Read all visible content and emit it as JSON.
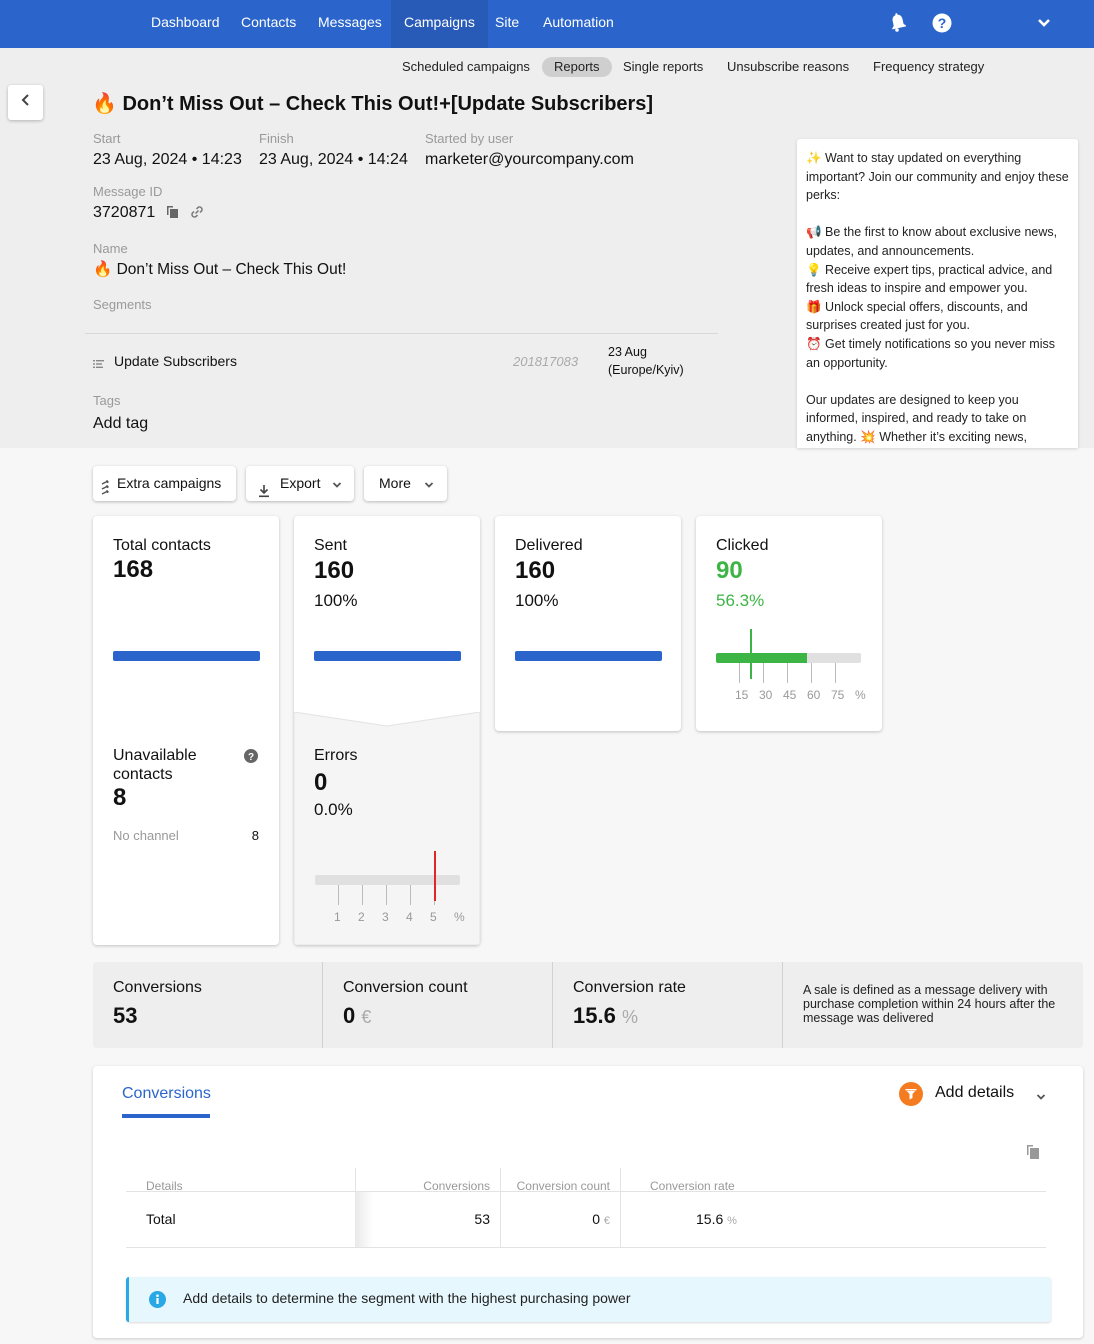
{
  "topnav": {
    "items": [
      {
        "label": "Dashboard"
      },
      {
        "label": "Contacts"
      },
      {
        "label": "Messages"
      },
      {
        "label": "Campaigns",
        "active": true
      },
      {
        "label": "Site"
      },
      {
        "label": "Automation"
      }
    ],
    "icons": [
      "bell-icon",
      "help-icon",
      "chevron-down-icon"
    ]
  },
  "subnav": {
    "items": [
      {
        "label": "Scheduled campaigns"
      },
      {
        "label": "Reports",
        "active": true
      },
      {
        "label": "Single reports"
      },
      {
        "label": "Unsubscribe reasons"
      },
      {
        "label": "Frequency strategy"
      }
    ]
  },
  "campaign": {
    "title": "🔥 Don’t Miss Out – Check This Out!+[Update Subscribers]",
    "start_label": "Start",
    "start_value": "23 Aug, 2024 • 14:23",
    "finish_label": "Finish",
    "finish_value": "23 Aug, 2024 • 14:24",
    "user_label": "Started by user",
    "user_value": "marketer@yourcompany.com",
    "message_id_label": "Message ID",
    "message_id_value": "3720871",
    "name_label": "Name",
    "name_value": "🔥 Don’t Miss Out – Check This Out!",
    "segments_label": "Segments",
    "segment": {
      "name": "Update Subscribers",
      "id": "201817083",
      "date": "23 Aug",
      "timezone": "(Europe/Kyiv)"
    },
    "tags_label": "Tags",
    "add_tag": "Add tag"
  },
  "preview": {
    "text": "✨ Want to stay updated on everything important? Join our community and enjoy these perks:\n\n📢 Be the first to know about exclusive news, updates, and announcements.\n💡 Receive expert tips, practical advice, and fresh ideas to inspire and empower you.\n🎁 Unlock special offers, discounts, and surprises created just for you.\n⏰ Get timely notifications so you never miss an opportunity.\n\nOur updates are designed to keep you informed, inspired, and ready to take on anything. 💥 Whether it’s exciting news,"
  },
  "actions": {
    "extra_campaigns": "Extra campaigns",
    "export": "Export",
    "more": "More"
  },
  "stats": {
    "total": {
      "label": "Total contacts",
      "value": "168",
      "bar_fraction": 1.0
    },
    "unavailable": {
      "label": "Unavailable contacts",
      "value": "8",
      "no_channel_label": "No channel",
      "no_channel_value": "8"
    },
    "sent": {
      "label": "Sent",
      "value": "160",
      "percent": "100%",
      "bar_fraction": 1.0
    },
    "errors": {
      "label": "Errors",
      "value": "0",
      "percent": "0.0%",
      "marker_percent": 5,
      "scale_max": 6,
      "ticks": [
        "1",
        "2",
        "3",
        "4",
        "5",
        "%"
      ]
    },
    "delivered": {
      "label": "Delivered",
      "value": "160",
      "percent": "100%",
      "bar_fraction": 1.0
    },
    "clicked": {
      "label": "Clicked",
      "value": "90",
      "percent": "56.3%",
      "fill_percent": 56.3,
      "marker_percent": 22,
      "scale_max": 90,
      "ticks": [
        "15",
        "30",
        "45",
        "60",
        "75",
        "%"
      ]
    }
  },
  "conversions_summary": {
    "conversions_label": "Conversions",
    "conversions_value": "53",
    "count_label": "Conversion count",
    "count_value": "0",
    "count_unit": "€",
    "rate_label": "Conversion rate",
    "rate_value": "15.6",
    "rate_unit": "%",
    "note": "A sale is defined as a message delivery with purchase completion within 24 hours after the message was delivered"
  },
  "conversions_panel": {
    "tab": "Conversions",
    "add_details": "Add details",
    "columns": [
      "Details",
      "Conversions",
      "Conversion count",
      "Conversion rate"
    ],
    "rows": [
      {
        "details": "Total",
        "conversions": "53",
        "count": "0",
        "count_unit": "€",
        "rate": "15.6",
        "rate_unit": "%"
      }
    ],
    "info": "Add details to determine the segment with the highest purchasing power"
  },
  "colors": {
    "brand": "#2b65cc",
    "success": "#3db545",
    "error": "#e0262b",
    "accent_orange": "#f47b20",
    "info": "#29a8e6"
  }
}
